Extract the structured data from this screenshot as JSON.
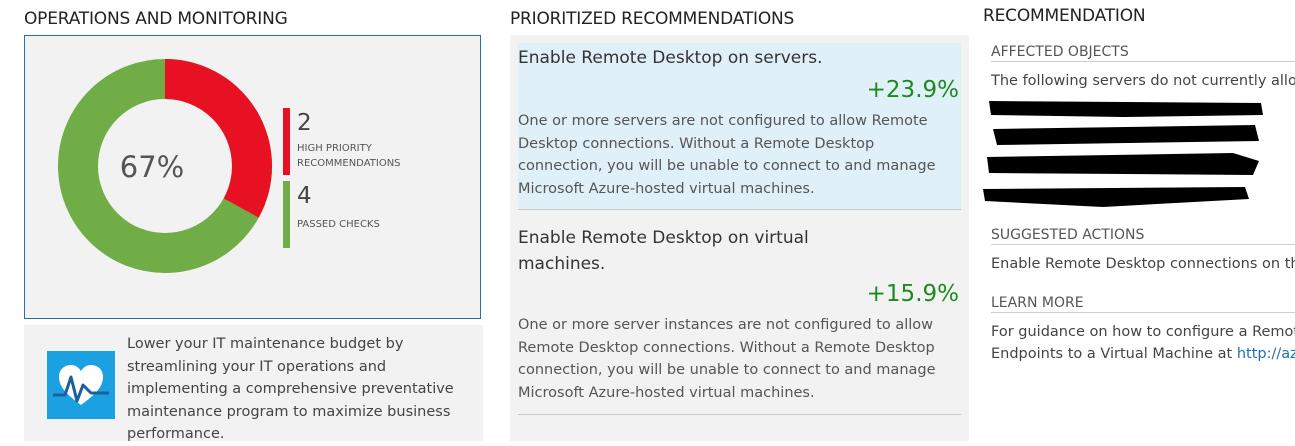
{
  "operations": {
    "title": "OPERATIONS AND MONITORING",
    "percent": "67%",
    "percent_value": 0.67,
    "legend": [
      {
        "count": "2",
        "label_line1": "HIGH PRIORITY",
        "label_line2": "RECOMMENDATIONS",
        "color": "#e81123"
      },
      {
        "count": "4",
        "label_line1": "PASSED CHECKS",
        "label_line2": "",
        "color": "#70ad47"
      }
    ],
    "tip": {
      "icon": "heart-pulse-icon",
      "text": "Lower your IT maintenance budget by streamlining your IT operations and implementing a comprehensive preventative maintenance program to maximize business performance."
    }
  },
  "prioritized": {
    "title": "PRIORITIZED RECOMMENDATIONS",
    "items": [
      {
        "title": "Enable Remote Desktop on servers.",
        "score": "+23.9%",
        "description": "One or more servers are not configured to allow Remote Desktop connections. Without a Remote Desktop connection, you will be unable to connect to and manage Microsoft Azure-hosted virtual machines."
      },
      {
        "title": "Enable Remote Desktop on virtual machines.",
        "score": "+15.9%",
        "description": "One or more server instances are not configured to allow Remote Desktop connections. Without a Remote Desktop connection, you will be unable to connect to and manage Microsoft Azure-hosted virtual machines."
      }
    ]
  },
  "recommendation": {
    "title": "RECOMMENDATION",
    "affected_heading": "AFFECTED OBJECTS",
    "affected_text": "The following servers do not currently allow",
    "suggested_heading": "SUGGESTED ACTIONS",
    "suggested_text": "Enable Remote Desktop connections on th",
    "learn_heading": "LEARN MORE",
    "learn_line1": "For guidance on how to configure a Remot",
    "learn_line2": "Endpoints to a Virtual Machine at ",
    "learn_link": "http://az"
  },
  "colors": {
    "accent_border": "#2a6ea6",
    "donut_red": "#e81123",
    "donut_green": "#70ad47",
    "score_green": "#1e8a1e",
    "selected_bg": "#dff0f9"
  }
}
